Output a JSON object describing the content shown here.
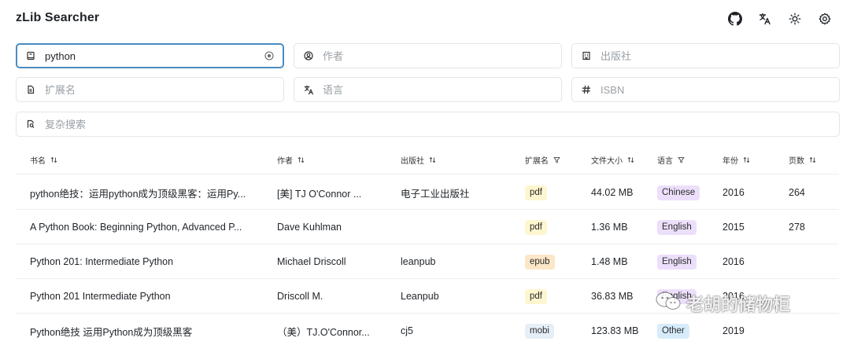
{
  "app": {
    "title": "zLib Searcher"
  },
  "header_icons": [
    {
      "name": "github-icon"
    },
    {
      "name": "translate-icon"
    },
    {
      "name": "sun-icon"
    },
    {
      "name": "gear-icon"
    }
  ],
  "search": {
    "title": {
      "value": "python",
      "placeholder": ""
    },
    "author": {
      "value": "",
      "placeholder": "作者"
    },
    "publisher": {
      "value": "",
      "placeholder": "出版社"
    },
    "extension": {
      "value": "",
      "placeholder": "扩展名"
    },
    "language": {
      "value": "",
      "placeholder": "语言"
    },
    "isbn": {
      "value": "",
      "placeholder": "ISBN"
    },
    "complex": {
      "value": "",
      "placeholder": "复杂搜索"
    }
  },
  "table": {
    "columns": {
      "title": "书名",
      "author": "作者",
      "publisher": "出版社",
      "extension": "扩展名",
      "size": "文件大小",
      "language": "语言",
      "year": "年份",
      "pages": "页数"
    },
    "rows": [
      {
        "title": "python绝技：运用python成为顶级黑客：运用Py...",
        "author": "[美] TJ O'Connor ...",
        "publisher": "电子工业出版社",
        "extension": "pdf",
        "size": "44.02 MB",
        "language": "Chinese",
        "year": "2016",
        "pages": "264"
      },
      {
        "title": "A Python Book: Beginning Python, Advanced P...",
        "author": "Dave Kuhlman",
        "publisher": "",
        "extension": "pdf",
        "size": "1.36 MB",
        "language": "English",
        "year": "2015",
        "pages": "278"
      },
      {
        "title": "Python 201: Intermediate Python",
        "author": "Michael Driscoll",
        "publisher": "leanpub",
        "extension": "epub",
        "size": "1.48 MB",
        "language": "English",
        "year": "2016",
        "pages": ""
      },
      {
        "title": "Python 201 Intermediate Python",
        "author": "Driscoll M.",
        "publisher": "Leanpub",
        "extension": "pdf",
        "size": "36.83 MB",
        "language": "English",
        "year": "2016",
        "pages": ""
      },
      {
        "title": "Python绝技 运用Python成为顶级黑客",
        "author": "（美）TJ.O'Connor...",
        "publisher": "cj5",
        "extension": "mobi",
        "size": "123.83 MB",
        "language": "Other",
        "year": "2019",
        "pages": ""
      }
    ]
  },
  "watermark": {
    "text": "老胡的储物柜"
  }
}
